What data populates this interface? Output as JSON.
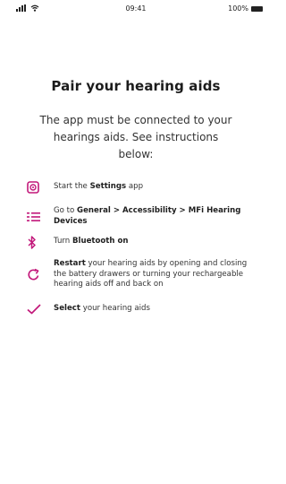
{
  "status_bar": {
    "time": "09:41",
    "battery_percent": "100%"
  },
  "page": {
    "title": "Pair your hearing aids",
    "subtitle": "The app must be connected to your hearings aids. See instructions below:"
  },
  "accent_color": "#c2187a",
  "steps": [
    {
      "icon": "settings-icon",
      "prefix": "Start the ",
      "bold": "Settings",
      "suffix": " app"
    },
    {
      "icon": "list-icon",
      "prefix": "Go to ",
      "bold": "General > Accessibility > MFi Hearing Devices",
      "suffix": ""
    },
    {
      "icon": "bluetooth-icon",
      "prefix": "Turn ",
      "bold": "Bluetooth on",
      "suffix": ""
    },
    {
      "icon": "restart-icon",
      "prefix": "",
      "bold": "Restart",
      "suffix": " your hearing aids by opening and closing the battery drawers or turning your rechargeable hearing aids off and back on"
    },
    {
      "icon": "checkmark-icon",
      "prefix": "",
      "bold": "Select",
      "suffix": " your hearing aids"
    }
  ]
}
